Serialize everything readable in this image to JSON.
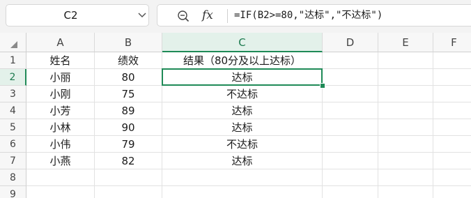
{
  "name_box": {
    "value": "C2"
  },
  "formula_bar": {
    "formula": "=IF(B2>=80,\"达标\",\"不达标\")",
    "fx_label": "fx"
  },
  "icons": {
    "zoom": "zoom-icon",
    "fx": "fx-icon",
    "chevron": "chevron-down-icon",
    "select_all": "select-all-triangle-icon"
  },
  "colors": {
    "accent": "#1f8a57",
    "selected_header_bg": "#e3f1ea"
  },
  "sheet": {
    "columns": [
      "A",
      "B",
      "C",
      "D",
      "E",
      "F"
    ],
    "rows": [
      "1",
      "2",
      "3",
      "4",
      "5",
      "6",
      "7",
      "8",
      "9"
    ],
    "selected_column": "C",
    "selected_row": "2",
    "active_cell": "C2",
    "cells": [
      [
        "姓名",
        "绩效",
        "结果（80分及以上达标）",
        "",
        "",
        ""
      ],
      [
        "小丽",
        "80",
        "达标",
        "",
        "",
        ""
      ],
      [
        "小刚",
        "75",
        "不达标",
        "",
        "",
        ""
      ],
      [
        "小芳",
        "89",
        "达标",
        "",
        "",
        ""
      ],
      [
        "小林",
        "90",
        "达标",
        "",
        "",
        ""
      ],
      [
        "小伟",
        "79",
        "不达标",
        "",
        "",
        ""
      ],
      [
        "小燕",
        "82",
        "达标",
        "",
        "",
        ""
      ],
      [
        "",
        "",
        "",
        "",
        "",
        ""
      ],
      [
        "",
        "",
        "",
        "",
        "",
        ""
      ]
    ]
  }
}
